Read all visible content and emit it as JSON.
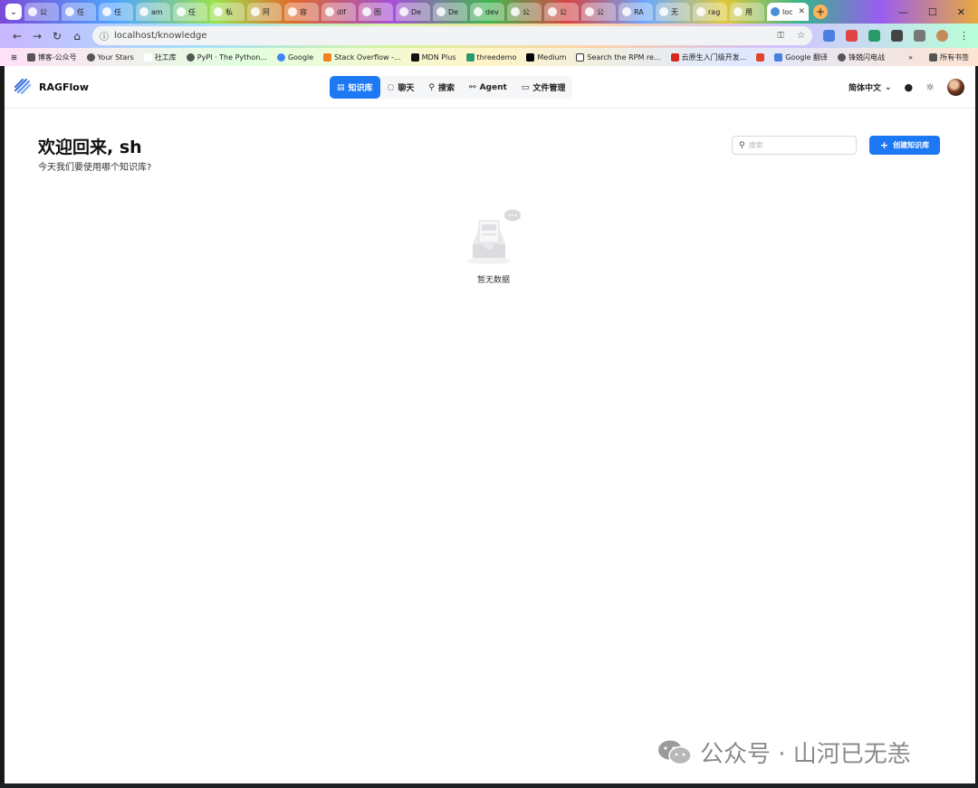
{
  "browser": {
    "tabs": [
      {
        "label": "公"
      },
      {
        "label": "任"
      },
      {
        "label": "任"
      },
      {
        "label": "am"
      },
      {
        "label": "任"
      },
      {
        "label": "私"
      },
      {
        "label": "阿"
      },
      {
        "label": "容"
      },
      {
        "label": "dif"
      },
      {
        "label": "图"
      },
      {
        "label": "De"
      },
      {
        "label": "De"
      },
      {
        "label": "dev"
      },
      {
        "label": "公"
      },
      {
        "label": "公"
      },
      {
        "label": "公"
      },
      {
        "label": "RA"
      },
      {
        "label": "无"
      },
      {
        "label": "rag"
      },
      {
        "label": "用"
      },
      {
        "label": "loc"
      }
    ],
    "active_tab_close": "✕",
    "new_tab": "+",
    "window_controls": {
      "min": "—",
      "max": "☐",
      "close": "✕"
    },
    "url": "localhost/knowledge",
    "bookmarks": [
      "博客-公众号",
      "Your Stars",
      "社工库",
      "PyPI · The Python...",
      "Google",
      "Stack Overflow -...",
      "MDN Plus",
      "threedemo",
      "Medium",
      "Search the RPM re...",
      "云原生入门级开发...",
      "Google 翻译",
      "锋兢闪电战"
    ],
    "bookmarks_more": "»",
    "all_bookmarks": "所有书签"
  },
  "app": {
    "logo_text": "RAGFlow",
    "nav": [
      {
        "label": "知识库",
        "icon": "database-icon"
      },
      {
        "label": "聊天",
        "icon": "chat-icon"
      },
      {
        "label": "搜索",
        "icon": "search-icon"
      },
      {
        "label": "Agent",
        "icon": "agent-icon"
      },
      {
        "label": "文件管理",
        "icon": "folder-icon"
      }
    ],
    "language": "简体中文",
    "welcome_title": "欢迎回来, sh",
    "welcome_subtitle": "今天我们要使用哪个知识库?",
    "search_placeholder": "搜索",
    "create_button": "创建知识库",
    "empty_text": "暂无数据",
    "accent_color": "#1d79f3"
  },
  "watermark": "公众号 · 山河已无恙"
}
